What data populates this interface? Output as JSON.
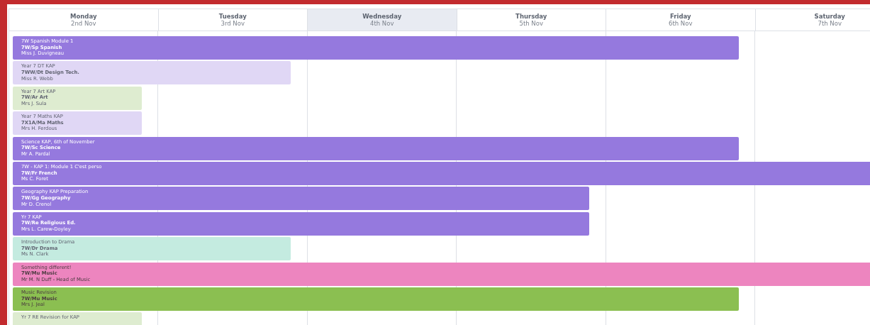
{
  "days": [
    {
      "name": "Monday",
      "date": "2nd Nov",
      "selected": false
    },
    {
      "name": "Tuesday",
      "date": "3rd Nov",
      "selected": false
    },
    {
      "name": "Wednesday",
      "date": "4th Nov",
      "selected": true
    },
    {
      "name": "Thursday",
      "date": "5th Nov",
      "selected": false
    },
    {
      "name": "Friday",
      "date": "6th Nov",
      "selected": false
    },
    {
      "name": "Saturday",
      "date": "7th Nov",
      "selected": false
    }
  ],
  "events": [
    {
      "kind": "five-day",
      "title": "7W Spanish Module 1",
      "subject": "7W/Sp Spanish",
      "teacher": "Miss J. Duvigneau",
      "color": "#9579de",
      "faded": false
    },
    {
      "kind": "two-day",
      "title": "Year 7 DT KAP",
      "subject": "7WW/Dt Design Tech.",
      "teacher": "Miss R. Webb",
      "color": "#e0d7f5",
      "faded": true
    },
    {
      "kind": "one-day",
      "title": "Year 7 Art KAP",
      "subject": "7W/Ar Art",
      "teacher": "Mrs J. Sula",
      "color": "#deecd0",
      "faded": true
    },
    {
      "kind": "one-day",
      "title": "Year 7 Maths KAP",
      "subject": "7X1A/Ma Maths",
      "teacher": "Mrs H. Ferdous",
      "color": "#e0d7f5",
      "faded": true
    },
    {
      "kind": "five-day",
      "title": "Science KAP, 6th of November",
      "subject": "7W/Sc Science",
      "teacher": "Mr A. Pardal",
      "color": "#9579de",
      "faded": false
    },
    {
      "kind": "ongoing",
      "title": "7W - KAP 1: Module 1 C'est perso",
      "subject": "7W/Fr French",
      "teacher": "Ms C. Foret",
      "color": "#9579de",
      "faded": false
    },
    {
      "kind": "four-day",
      "title": "Geography KAP Preparation",
      "subject": "7W/Gg Geography",
      "teacher": "Mr D. Crenol",
      "color": "#9579de",
      "faded": false
    },
    {
      "kind": "four-day",
      "title": "Yr 7 KAP",
      "subject": "7W/Re Religious Ed.",
      "teacher": "Mrs L. Carew-Doyley",
      "color": "#9579de",
      "faded": false
    },
    {
      "kind": "two-day",
      "title": "Introduction to Drama",
      "subject": "7W/Dr Drama",
      "teacher": "Ms N. Clark",
      "color": "#c4ebe0",
      "faded": true
    },
    {
      "kind": "ongoing",
      "title": "Something different!",
      "subject": "7W/Mu Music",
      "teacher": "Mr M. N Duff - Head of Music",
      "color": "#ed85bf",
      "faded": false
    },
    {
      "kind": "five-day",
      "title": "Music Revision",
      "subject": "7W/Mu Music",
      "teacher": "Mrs J. Jeal",
      "color": "#8bbf51",
      "faded": false
    },
    {
      "kind": "one-day",
      "title": "Yr 7 RE Revision for KAP",
      "color": "#deecd0",
      "faded": true
    }
  ]
}
